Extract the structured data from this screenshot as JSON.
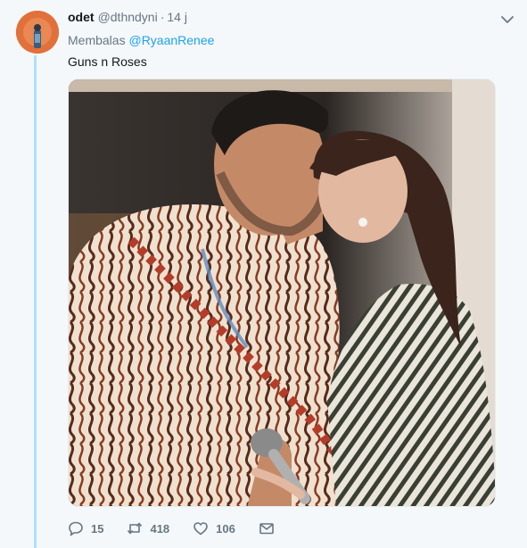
{
  "tweet": {
    "author_name": "odet",
    "author_handle": "@dthndyni",
    "separator": "·",
    "timestamp": "14 j",
    "reply_prefix": "Membalas",
    "reply_mention": "@RyaanRenee",
    "text": "Guns n Roses",
    "media_icon": "photo",
    "colors": {
      "link": "#1da1f2",
      "thread_line": "#aee0ff",
      "muted": "#657786",
      "background": "#f5f8fa"
    }
  },
  "actions": {
    "reply": {
      "icon": "reply-icon",
      "count": "15"
    },
    "retweet": {
      "icon": "retweet-icon",
      "count": "418"
    },
    "like": {
      "icon": "heart-icon",
      "count": "106"
    },
    "dm": {
      "icon": "envelope-icon"
    }
  },
  "menu": {
    "icon": "chevron-down-icon"
  }
}
